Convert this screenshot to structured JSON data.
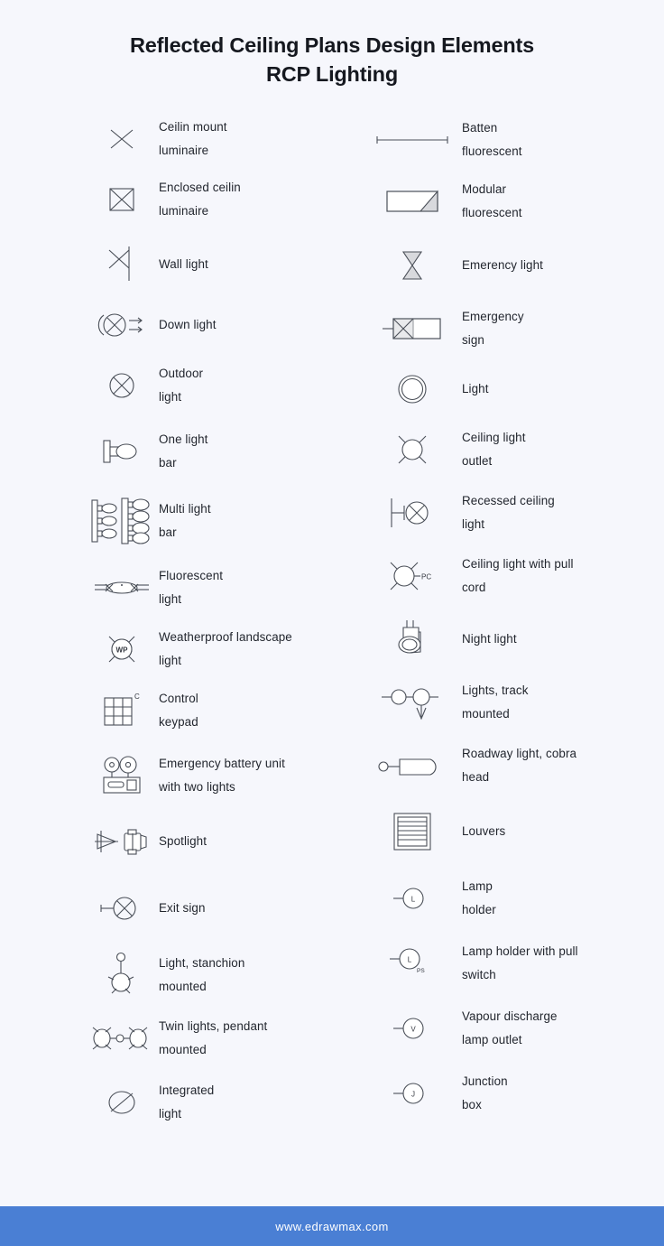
{
  "header": {
    "title_line1": "Reflected Ceiling Plans Design Elements",
    "title_line2": "RCP Lighting"
  },
  "colors": {
    "background": "#f6f7fc",
    "footer_bar": "#4a7fd4",
    "footer_text": "#ffffff",
    "title_text": "#15181f",
    "label_text": "#22262e",
    "symbol_stroke": "#4a4f58",
    "symbol_fill_gray": "#d8d9dd"
  },
  "legend": {
    "left_column": [
      {
        "icon": "ceiling-mount-luminaire-icon",
        "label": "Ceilin mount\nluminaire"
      },
      {
        "icon": "enclosed-ceiling-luminaire-icon",
        "label": "Enclosed ceilin\nluminaire"
      },
      {
        "icon": "wall-light-icon",
        "label": "Wall light"
      },
      {
        "icon": "down-light-icon",
        "label": "Down light"
      },
      {
        "icon": "outdoor-light-icon",
        "label": "Outdoor\nlight"
      },
      {
        "icon": "one-light-bar-icon",
        "label": "One light\nbar"
      },
      {
        "icon": "multi-light-bar-icon",
        "label": "Multi light\nbar"
      },
      {
        "icon": "fluorescent-light-icon",
        "label": "Fluorescent\nlight"
      },
      {
        "icon": "weatherproof-landscape-light-icon",
        "label": "Weatherproof landscape\nlight",
        "symbol_text": "WP"
      },
      {
        "icon": "control-keypad-icon",
        "label": "Control\nkeypad",
        "symbol_text": "C"
      },
      {
        "icon": "emergency-battery-unit-icon",
        "label": "Emergency battery unit\nwith two lights"
      },
      {
        "icon": "spotlight-icon",
        "label": "Spotlight"
      },
      {
        "icon": "exit-sign-icon",
        "label": "Exit sign"
      },
      {
        "icon": "light-stanchion-mounted-icon",
        "label": "Light, stanchion\nmounted"
      },
      {
        "icon": "twin-lights-pendant-mounted-icon",
        "label": "Twin lights, pendant\nmounted"
      },
      {
        "icon": "integrated-light-icon",
        "label": "Integrated\nlight"
      }
    ],
    "right_column": [
      {
        "icon": "batten-fluorescent-icon",
        "label": "Batten\nfluorescent"
      },
      {
        "icon": "modular-fluorescent-icon",
        "label": "Modular\nfluorescent"
      },
      {
        "icon": "emergency-light-icon",
        "label": "Emerency light"
      },
      {
        "icon": "emergency-sign-icon",
        "label": "Emergency\nsign"
      },
      {
        "icon": "light-icon",
        "label": "Light"
      },
      {
        "icon": "ceiling-light-outlet-icon",
        "label": "Ceiling light\noutlet"
      },
      {
        "icon": "recessed-ceiling-light-icon",
        "label": "Recessed ceiling\nlight"
      },
      {
        "icon": "ceiling-light-with-pull-cord-icon",
        "label": "Ceiling light with pull\ncord",
        "symbol_text": "PC"
      },
      {
        "icon": "night-light-icon",
        "label": "Night light"
      },
      {
        "icon": "lights-track-mounted-icon",
        "label": "Lights, track\nmounted"
      },
      {
        "icon": "roadway-light-cobra-head-icon",
        "label": "Roadway light, cobra\nhead"
      },
      {
        "icon": "louvers-icon",
        "label": "Louvers"
      },
      {
        "icon": "lamp-holder-icon",
        "label": "Lamp\nholder",
        "symbol_text": "L"
      },
      {
        "icon": "lamp-holder-with-pull-switch-icon",
        "label": "Lamp holder with pull\nswitch",
        "symbol_text": "L",
        "symbol_text2": "PS"
      },
      {
        "icon": "vapour-discharge-lamp-outlet-icon",
        "label": "Vapour discharge\nlamp outlet",
        "symbol_text": "V"
      },
      {
        "icon": "junction-box-icon",
        "label": "Junction\nbox",
        "symbol_text": "J"
      }
    ]
  },
  "footer": {
    "url": "www.edrawmax.com"
  }
}
